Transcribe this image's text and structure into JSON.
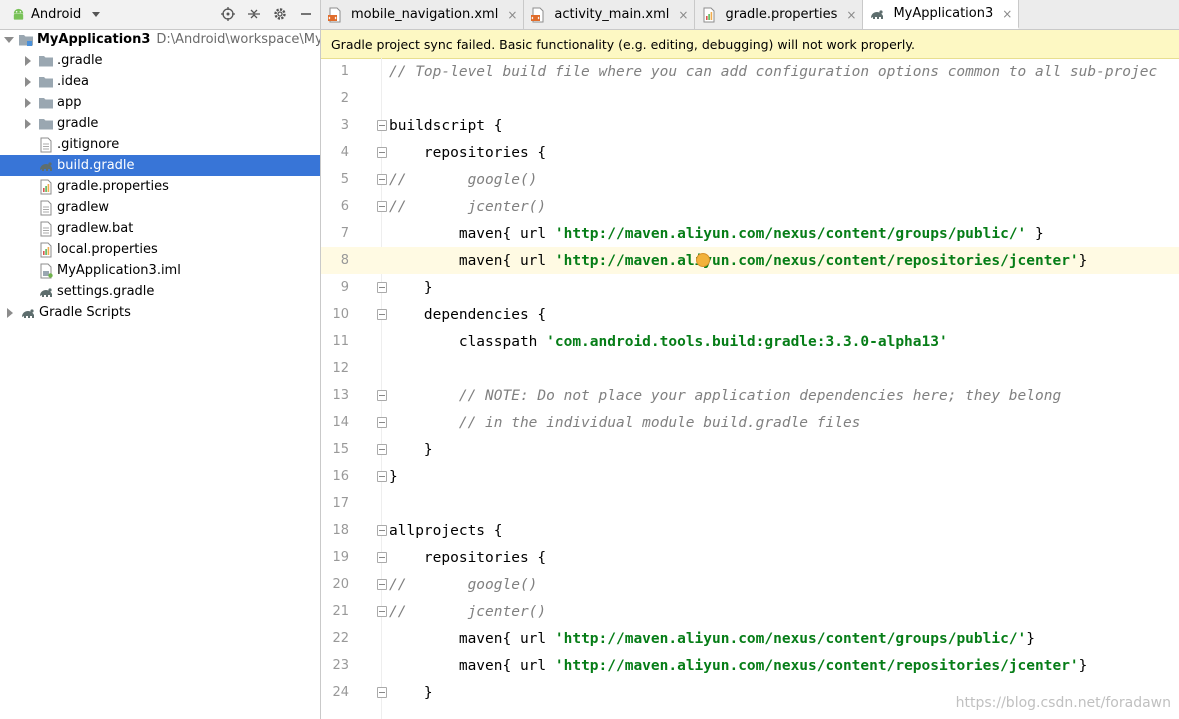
{
  "project_panel": {
    "view_selector": "Android",
    "tree": [
      {
        "label": "MyApplication3",
        "path": "D:\\Android\\workspace\\MyApp",
        "level": 0,
        "expanded": true,
        "icon": "module-folder-icon",
        "bold": true
      },
      {
        "label": ".gradle",
        "level": 1,
        "expanded": false,
        "icon": "folder-icon"
      },
      {
        "label": ".idea",
        "level": 1,
        "expanded": false,
        "icon": "folder-icon"
      },
      {
        "label": "app",
        "level": 1,
        "expanded": false,
        "icon": "folder-icon"
      },
      {
        "label": "gradle",
        "level": 1,
        "expanded": false,
        "icon": "folder-icon"
      },
      {
        "label": ".gitignore",
        "level": 1,
        "icon": "file-icon"
      },
      {
        "label": "build.gradle",
        "level": 1,
        "icon": "gradle-file-icon",
        "selected": true
      },
      {
        "label": "gradle.properties",
        "level": 1,
        "icon": "properties-file-icon"
      },
      {
        "label": "gradlew",
        "level": 1,
        "icon": "file-icon"
      },
      {
        "label": "gradlew.bat",
        "level": 1,
        "icon": "file-icon"
      },
      {
        "label": "local.properties",
        "level": 1,
        "icon": "properties-file-icon"
      },
      {
        "label": "MyApplication3.iml",
        "level": 1,
        "icon": "iml-file-icon"
      },
      {
        "label": "settings.gradle",
        "level": 1,
        "icon": "gradle-file-icon"
      },
      {
        "label": "Gradle Scripts",
        "level": 0,
        "expanded": false,
        "icon": "gradle-scripts-icon"
      }
    ]
  },
  "tabs": [
    {
      "label": "mobile_navigation.xml",
      "icon": "xml-file-icon",
      "active": false
    },
    {
      "label": "activity_main.xml",
      "icon": "xml-file-icon",
      "active": false
    },
    {
      "label": "gradle.properties",
      "icon": "properties-file-icon",
      "active": false
    },
    {
      "label": "MyApplication3",
      "icon": "gradle-file-icon",
      "active": true
    }
  ],
  "banner": "Gradle project sync failed. Basic functionality (e.g. editing, debugging) will not work properly.",
  "code_lines": [
    {
      "n": "1",
      "parts": [
        {
          "t": "// Top-level build file where you can add configuration options common to all sub-projec",
          "c": "cm"
        }
      ]
    },
    {
      "n": "2",
      "parts": []
    },
    {
      "n": "3",
      "fold": true,
      "parts": [
        {
          "t": "buildscript {",
          "c": "kw"
        }
      ]
    },
    {
      "n": "4",
      "fold": true,
      "parts": [
        {
          "t": "    repositories {",
          "c": "kw"
        }
      ]
    },
    {
      "n": "5",
      "fold": true,
      "parts": [
        {
          "t": "//       google()",
          "c": "cm"
        }
      ]
    },
    {
      "n": "6",
      "fold": true,
      "parts": [
        {
          "t": "//       jcenter()",
          "c": "cm"
        }
      ]
    },
    {
      "n": "7",
      "parts": [
        {
          "t": "        maven{ url ",
          "c": "kw"
        },
        {
          "t": "'http://maven.aliyun.com/nexus/content/groups/public/'",
          "c": "str"
        },
        {
          "t": " }",
          "c": "kw"
        }
      ]
    },
    {
      "n": "8",
      "hl": true,
      "bulb": true,
      "parts": [
        {
          "t": "        maven{ url ",
          "c": "kw"
        },
        {
          "t": "'http://maven.aliyun.com/nexus/content/repositories/jcenter'",
          "c": "str"
        },
        {
          "t": "}",
          "c": "kw"
        }
      ]
    },
    {
      "n": "9",
      "fold": true,
      "parts": [
        {
          "t": "    }",
          "c": "kw"
        }
      ]
    },
    {
      "n": "10",
      "fold": true,
      "parts": [
        {
          "t": "    dependencies {",
          "c": "kw"
        }
      ]
    },
    {
      "n": "11",
      "parts": [
        {
          "t": "        classpath ",
          "c": "kw"
        },
        {
          "t": "'com.android.tools.build:gradle:3.3.0-alpha13'",
          "c": "str"
        }
      ]
    },
    {
      "n": "12",
      "parts": []
    },
    {
      "n": "13",
      "fold": true,
      "parts": [
        {
          "t": "        // NOTE: Do not place your application dependencies here; they belong",
          "c": "cm"
        }
      ]
    },
    {
      "n": "14",
      "fold": true,
      "parts": [
        {
          "t": "        // in the individual module build.gradle files",
          "c": "cm"
        }
      ]
    },
    {
      "n": "15",
      "fold": true,
      "parts": [
        {
          "t": "    }",
          "c": "kw"
        }
      ]
    },
    {
      "n": "16",
      "fold": true,
      "parts": [
        {
          "t": "}",
          "c": "kw"
        }
      ]
    },
    {
      "n": "17",
      "parts": []
    },
    {
      "n": "18",
      "fold": true,
      "parts": [
        {
          "t": "allprojects {",
          "c": "kw"
        }
      ]
    },
    {
      "n": "19",
      "fold": true,
      "parts": [
        {
          "t": "    repositories {",
          "c": "kw"
        }
      ]
    },
    {
      "n": "20",
      "fold": true,
      "parts": [
        {
          "t": "//       google()",
          "c": "cm"
        }
      ]
    },
    {
      "n": "21",
      "fold": true,
      "parts": [
        {
          "t": "//       jcenter()",
          "c": "cm"
        }
      ]
    },
    {
      "n": "22",
      "parts": [
        {
          "t": "        maven{ url ",
          "c": "kw"
        },
        {
          "t": "'http://maven.aliyun.com/nexus/content/groups/public/'",
          "c": "str"
        },
        {
          "t": "}",
          "c": "kw"
        }
      ]
    },
    {
      "n": "23",
      "parts": [
        {
          "t": "        maven{ url ",
          "c": "kw"
        },
        {
          "t": "'http://maven.aliyun.com/nexus/content/repositories/jcenter'",
          "c": "str"
        },
        {
          "t": "}",
          "c": "kw"
        }
      ]
    },
    {
      "n": "24",
      "fold": true,
      "parts": [
        {
          "t": "    }",
          "c": "kw"
        }
      ]
    }
  ],
  "watermark": "https://blog.csdn.net/foradawn",
  "colors": {
    "selection": "#3875d7",
    "banner": "#fdf8c3",
    "string": "#067d17",
    "comment": "#808080"
  }
}
